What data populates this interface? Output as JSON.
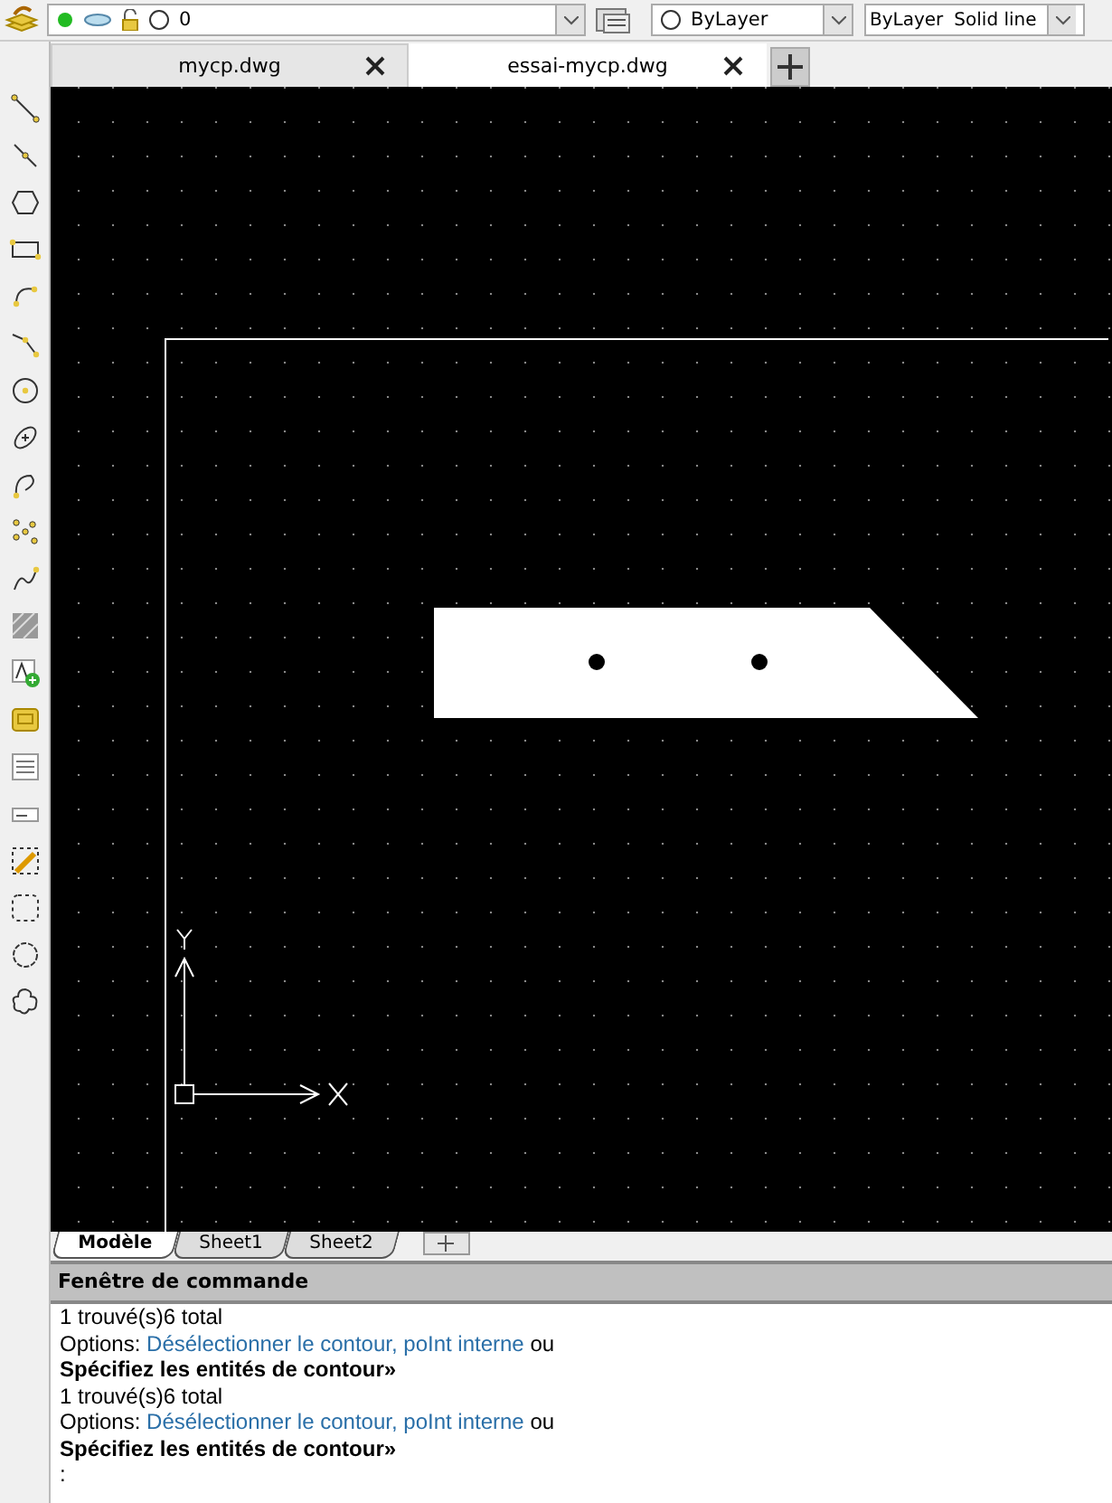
{
  "toolbar": {
    "layer": {
      "value": "0",
      "on": true
    },
    "color": {
      "value": "ByLayer"
    },
    "linetype": {
      "value": "ByLayer",
      "description": "Solid line"
    }
  },
  "tabs": [
    {
      "label": "mycp.dwg",
      "selected": false
    },
    {
      "label": "essai-mycp.dwg",
      "selected": true
    }
  ],
  "layout_tabs": [
    {
      "label": "Modèle",
      "selected": true
    },
    {
      "label": "Sheet1",
      "selected": false
    },
    {
      "label": "Sheet2",
      "selected": false
    }
  ],
  "command_window": {
    "title": "Fenêtre de commande",
    "lines": [
      {
        "kind": "text",
        "text": "1 trouvé(s)6 total"
      },
      {
        "kind": "options",
        "prefix": "Options:",
        "links": [
          "Désélectionner le contour,",
          "poInt interne"
        ],
        "suffix": "ou"
      },
      {
        "kind": "prompt",
        "text": "Spécifiez les entités de contour»"
      },
      {
        "kind": "text",
        "text": "1 trouvé(s)6 total"
      },
      {
        "kind": "options",
        "prefix": "Options:",
        "links": [
          "Désélectionner le contour,",
          "poInt interne"
        ],
        "suffix": "ou"
      },
      {
        "kind": "prompt",
        "text": "Spécifiez les entités de contour»"
      },
      {
        "kind": "text",
        "text": ":"
      }
    ]
  }
}
